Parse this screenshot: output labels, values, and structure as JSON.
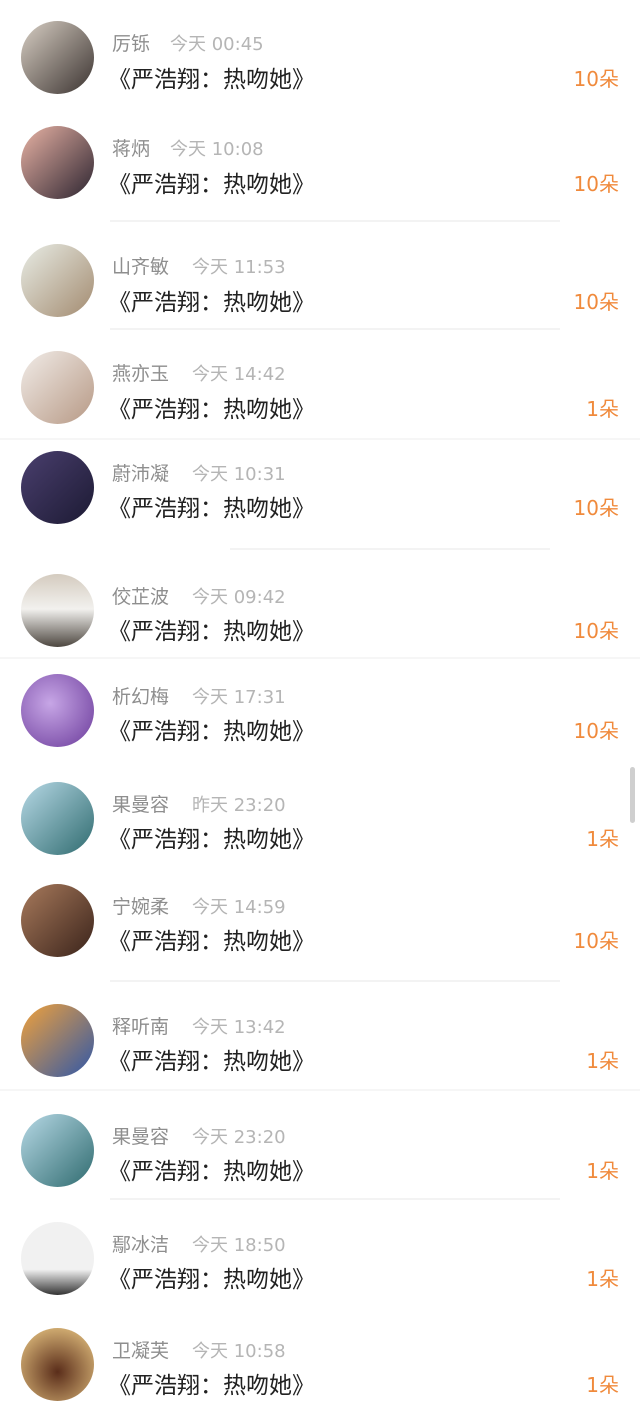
{
  "gifts": {
    "title": "《严浩翔：热吻她》",
    "accent_color": "#f08a3c",
    "rows": [
      {
        "name": "厉铄",
        "time": "今天 00:45",
        "count": "10朵",
        "avatar_colors": [
          "#d8cfc4",
          "#3b3330"
        ]
      },
      {
        "name": "蒋炳",
        "time": "今天 10:08",
        "count": "10朵",
        "avatar_colors": [
          "#e9b3a5",
          "#2c2430"
        ]
      },
      {
        "name": "山齐敏",
        "time": "今天 11:53",
        "count": "10朵",
        "avatar_colors": [
          "#e8ece5",
          "#a38b70"
        ]
      },
      {
        "name": "燕亦玉",
        "time": "今天 14:42",
        "count": "1朵",
        "avatar_colors": [
          "#f1ece8",
          "#b79985"
        ]
      },
      {
        "name": "蔚沛凝",
        "time": "今天 10:31",
        "count": "10朵",
        "avatar_colors": [
          "#4a3f6e",
          "#1c1a33"
        ]
      },
      {
        "name": "佼芷波",
        "time": "今天 09:42",
        "count": "10朵",
        "avatar_colors": [
          "#d4cbbf",
          "#4d4740"
        ]
      },
      {
        "name": "析幻梅",
        "time": "今天 17:31",
        "count": "10朵",
        "avatar_colors": [
          "#c7a6e6",
          "#6a3a9a"
        ]
      },
      {
        "name": "果曼容",
        "time": "昨天 23:20",
        "count": "1朵",
        "avatar_colors": [
          "#b7d9e6",
          "#2f6b6f"
        ]
      },
      {
        "name": "宁婉柔",
        "time": "今天 14:59",
        "count": "10朵",
        "avatar_colors": [
          "#a87a5c",
          "#3a231a"
        ]
      },
      {
        "name": "释听南",
        "time": "今天 13:42",
        "count": "1朵",
        "avatar_colors": [
          "#f2a23a",
          "#2f57a8"
        ]
      },
      {
        "name": "果曼容",
        "time": "今天 23:20",
        "count": "1朵",
        "avatar_colors": [
          "#b7d9e6",
          "#2f6b6f"
        ]
      },
      {
        "name": "鄢冰洁",
        "time": "今天 18:50",
        "count": "1朵",
        "avatar_colors": [
          "#f1f1f1",
          "#333333"
        ]
      },
      {
        "name": "卫凝芙",
        "time": "今天 10:58",
        "count": "1朵",
        "avatar_colors": [
          "#f2d08a",
          "#5a2d1a"
        ]
      }
    ]
  }
}
